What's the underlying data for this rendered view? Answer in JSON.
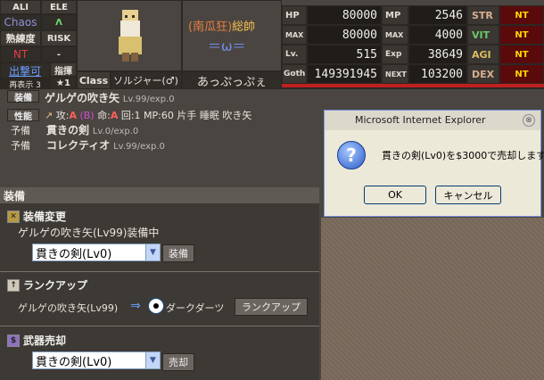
{
  "profile": {
    "ali_label": "ALI",
    "ele_label": "ELE",
    "chaos": "Chaos",
    "ele_value": "Λ",
    "jukuren_label": "熟練度",
    "risk_label": "RISK",
    "nt": "NT",
    "risk_value": "-",
    "shugeki": "出撃可",
    "shiki_label": "指揮",
    "rank_label": "再表示 3",
    "star": "★1",
    "title_left": "(南瓜狂)",
    "title_right": "総帥",
    "emblem": "＝ω＝",
    "class_label": "Class",
    "class_value": "ソルジャー(♂)",
    "char_name": "あっぷっぷぇ"
  },
  "stats": {
    "rows": [
      {
        "label": "HP",
        "value": "80000",
        "label2": "MP",
        "value2": "2546",
        "ability": "STR",
        "ability_color": "#d8a080",
        "nt": "NT"
      },
      {
        "label": "MAX",
        "value": "80000",
        "label2": "MAX",
        "value2": "4000",
        "ability": "VIT",
        "ability_color": "#6cc96c",
        "nt": "NT"
      },
      {
        "label": "Lv.",
        "value": "515",
        "label2": "Exp",
        "value2": "38649",
        "ability": "AGI",
        "ability_color": "#d8c060",
        "nt": "NT"
      },
      {
        "label": "Goth",
        "value": "149391945",
        "label2": "NEXT",
        "value2": "103200",
        "ability": "DEX",
        "ability_color": "#d8a080",
        "nt": "NT"
      }
    ]
  },
  "equip_info": {
    "soubi_label": "装備",
    "weapon_name": "ゲルゲの吹き矢",
    "weapon_lv": "Lv.99/exp.0",
    "seinou_label": "性能",
    "perf_a": "攻:",
    "perf_a_val": "A",
    "perf_b": "(B)",
    "perf_c": "命:",
    "perf_c_val": "A",
    "perf_rest": "回:1 MP:60 片手 睡眠 吹き矢",
    "yobi_label": "予備",
    "yobi1_name": "貫きの剣",
    "yobi1_lv": "Lv.0/exp.0",
    "yobi2_name": "コレクティオ",
    "yobi2_lv": "Lv.99/exp.0"
  },
  "panel": {
    "header": "装備",
    "change_title": "装備変更",
    "change_status": "ゲルゲの吹き矢(Lv99)装備中",
    "change_select": "貫きの剣(Lv0)",
    "change_button": "装備",
    "rankup_title": "ランクアップ",
    "rankup_from": "ゲルゲの吹き矢(Lv99)",
    "rankup_arrow": "⇒",
    "rankup_to": "ダークダーツ",
    "rankup_button": "ランクアップ",
    "sell_title": "武器売却",
    "sell_select": "貫きの剣(Lv0)",
    "sell_button": "売却"
  },
  "dialog": {
    "title": "Microsoft Internet Explorer",
    "message": "貫きの剣(Lv0)を$3000で売却します",
    "ok": "OK",
    "cancel": "キャンセル"
  }
}
